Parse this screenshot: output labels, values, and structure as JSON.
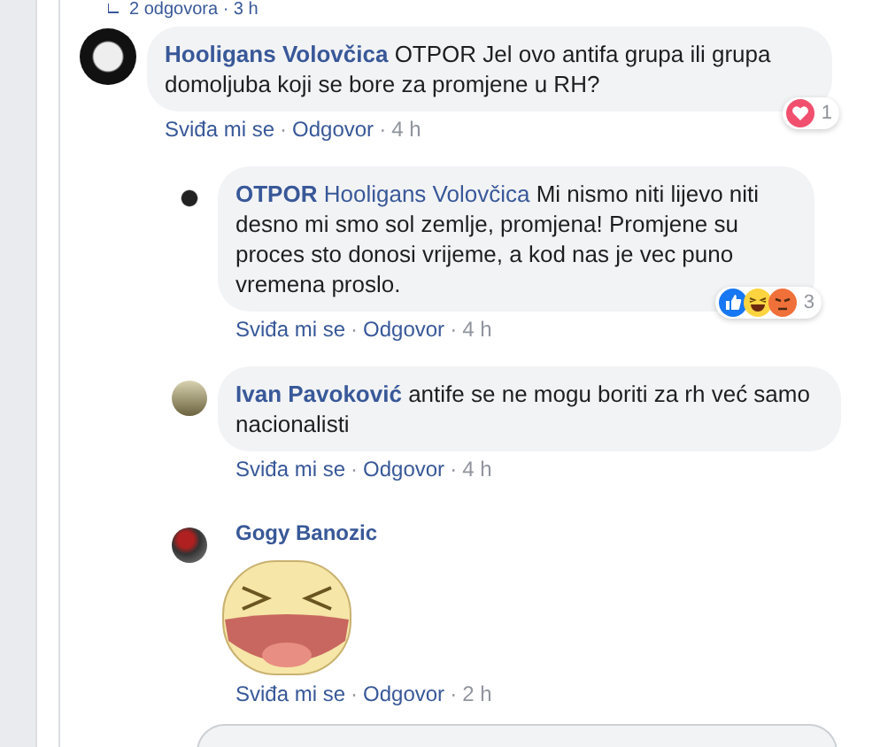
{
  "top_replies_link": {
    "text": "2 odgovora · 3 h"
  },
  "comment": {
    "author": "Hooligans Volovčica",
    "text": "OTPOR Jel ovo antifa grupa ili grupa domoljuba koji se bore za promjene u RH?",
    "separator": "·",
    "actions": [
      "Sviđa mi se",
      "Odgovor",
      "4 h"
    ],
    "reactions": {
      "items": [
        {
          "kind": "love"
        }
      ],
      "count": "1"
    }
  },
  "replies": [
    {
      "kind": "text",
      "author": "OTPOR",
      "tag": "Hooligans Volovčica",
      "text": "Mi nismo niti lijevo niti desno mi smo sol zemlje, promjena! Promjene su proces sto donosi vrijeme, a kod nas je vec puno vremena proslo.",
      "separator": "·",
      "actions": [
        "Sviđa mi se",
        "Odgovor",
        "4 h"
      ],
      "reactions": {
        "items": [
          {
            "kind": "like"
          },
          {
            "kind": "haha"
          },
          {
            "kind": "angry"
          }
        ],
        "count": "3"
      }
    },
    {
      "kind": "text",
      "author": "Ivan Pavoković",
      "text": "antife se ne mogu boriti za rh već samo nacionalisti",
      "separator": "·",
      "actions": [
        "Sviđa mi se",
        "Odgovor",
        "4 h"
      ]
    },
    {
      "kind": "sticker",
      "author": "Gogy Banozic",
      "separator": "·",
      "actions": [
        "Sviđa mi se",
        "Odgovor",
        "2 h"
      ]
    }
  ]
}
